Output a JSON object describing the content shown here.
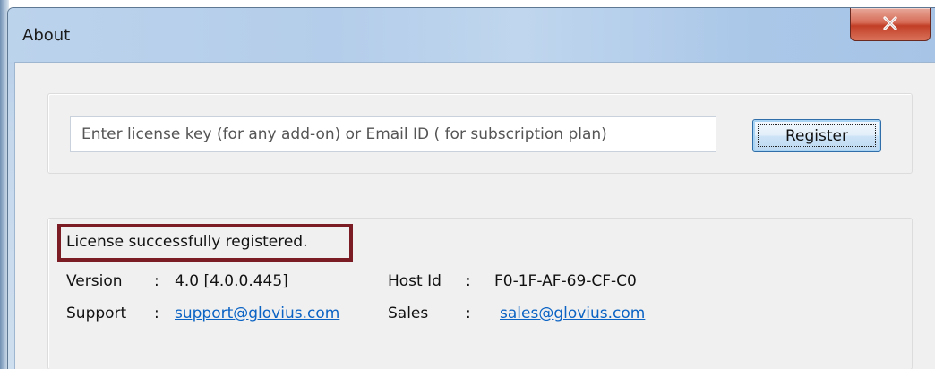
{
  "window": {
    "title": "About",
    "close_glyph": "x"
  },
  "license": {
    "placeholder": "Enter license key (for any add-on) or Email ID ( for subscription plan)",
    "value": "",
    "register_label_underlined": "R",
    "register_label_rest": "egister"
  },
  "status": {
    "message": "License successfully registered."
  },
  "info": {
    "version_label": "Version",
    "version_sep": ":",
    "version_value": "4.0 [4.0.0.445]",
    "hostid_label": "Host Id",
    "hostid_sep": ":",
    "hostid_value": "F0-1F-AF-69-CF-C0",
    "support_label": "Support",
    "support_sep": ":",
    "support_link": "support@glovius.com",
    "sales_label": "Sales",
    "sales_sep": ":",
    "sales_link": "sales@glovius.com"
  },
  "colors": {
    "highlight_border": "#7b1c24",
    "link": "#0b63c4",
    "close_button": "#c23e26"
  }
}
